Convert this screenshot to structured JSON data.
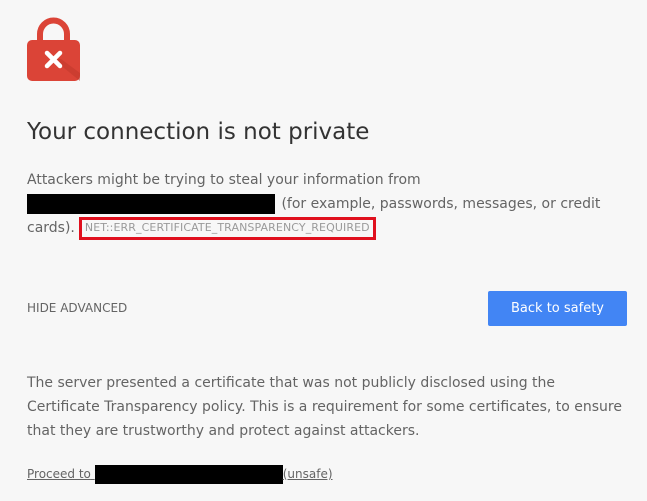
{
  "page": {
    "title": "Your connection is not private",
    "intro_before": "Attackers might be trying to steal your information from",
    "intro_after": " (for example, passwords, messages, or credit cards).",
    "error_code": "NET::ERR_CERTIFICATE_TRANSPARENCY_REQUIRED",
    "hide_advanced_label": "HIDE ADVANCED",
    "back_button_label": "Back to safety",
    "details_text": "The server presented a certificate that was not publicly disclosed using the Certificate Transparency policy. This is a requirement for some certificates, to ensure that they are trustworthy and protect against attackers.",
    "proceed_prefix": "Proceed to",
    "proceed_suffix": "(unsafe)"
  },
  "colors": {
    "lock_red": "#db4437",
    "button_blue": "#4285f4",
    "highlight_red": "#e0101e"
  },
  "icons": {
    "lock": "lock-error-icon"
  }
}
